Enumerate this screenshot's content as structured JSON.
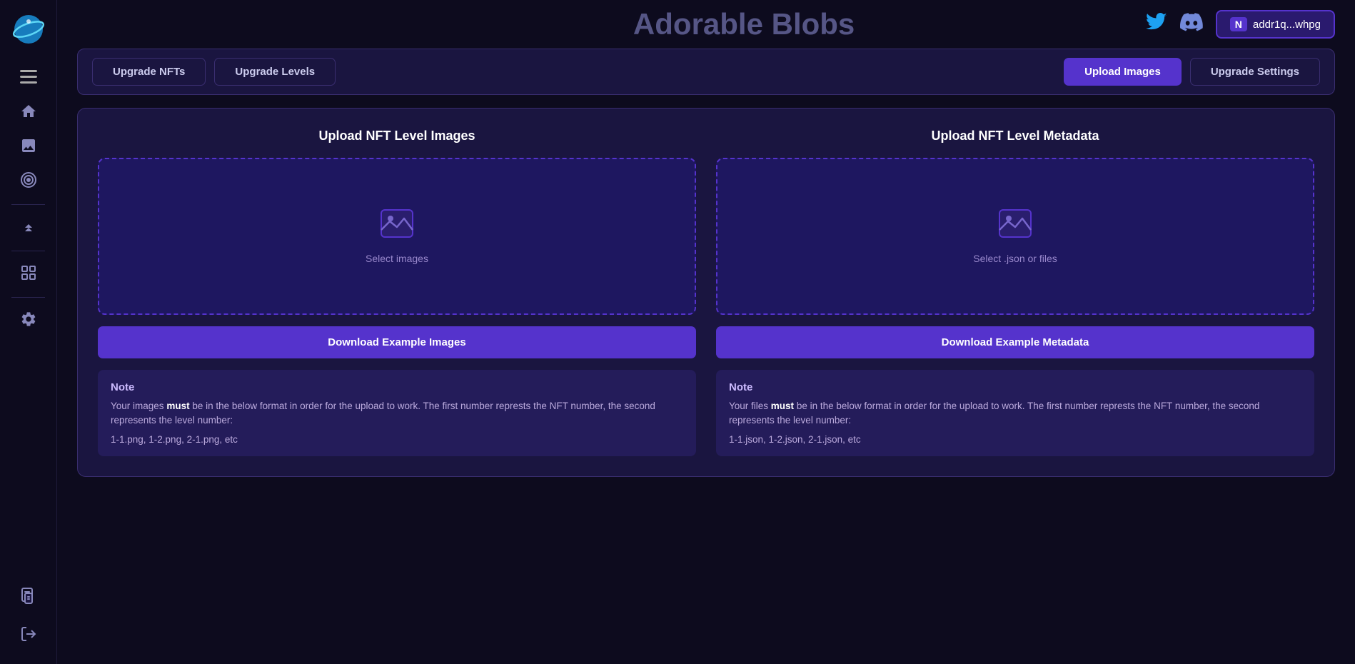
{
  "app": {
    "title": "Adorable Blobs"
  },
  "sidebar": {
    "logo_alt": "Planet Logo",
    "menu_icon": "☰",
    "icons": [
      {
        "name": "home-icon",
        "glyph": "🏠"
      },
      {
        "name": "image-icon",
        "glyph": "🖼"
      },
      {
        "name": "target-icon",
        "glyph": "🎯"
      },
      {
        "name": "chevron-up-icon",
        "glyph": "⬆"
      },
      {
        "name": "grid-icon",
        "glyph": "⊞"
      },
      {
        "name": "settings-icon",
        "glyph": "⚙"
      }
    ],
    "bottom_icons": [
      {
        "name": "document-icon",
        "glyph": "📋"
      },
      {
        "name": "logout-icon",
        "glyph": "📤"
      }
    ]
  },
  "topbar": {
    "twitter_label": "Twitter",
    "discord_label": "Discord",
    "wallet_network": "N",
    "wallet_address": "addr1q...whpg"
  },
  "tabs": [
    {
      "id": "upgrade-nfts",
      "label": "Upgrade NFTs",
      "active": false
    },
    {
      "id": "upgrade-levels",
      "label": "Upgrade Levels",
      "active": false
    },
    {
      "id": "upload-images",
      "label": "Upload Images",
      "active": true
    },
    {
      "id": "upgrade-settings",
      "label": "Upgrade Settings",
      "active": false
    }
  ],
  "upload": {
    "images_section": {
      "title": "Upload NFT Level Images",
      "dropzone_label": "Select images",
      "download_btn": "Download Example Images",
      "note_title": "Note",
      "note_text_1": "Your images ",
      "note_bold": "must",
      "note_text_2": " be in the below format in order for the upload to work. The first number represts the NFT number, the second represents the level number:",
      "note_example": "1-1.png, 1-2.png, 2-1.png, etc"
    },
    "metadata_section": {
      "title": "Upload NFT Level Metadata",
      "dropzone_label": "Select .json or files",
      "download_btn": "Download Example Metadata",
      "note_title": "Note",
      "note_text_1": "Your files ",
      "note_bold": "must",
      "note_text_2": " be in the below format in order for the upload to work. The first number represts the NFT number, the second represents the level number:",
      "note_example": "1-1.json, 1-2.json, 2-1.json, etc"
    }
  }
}
